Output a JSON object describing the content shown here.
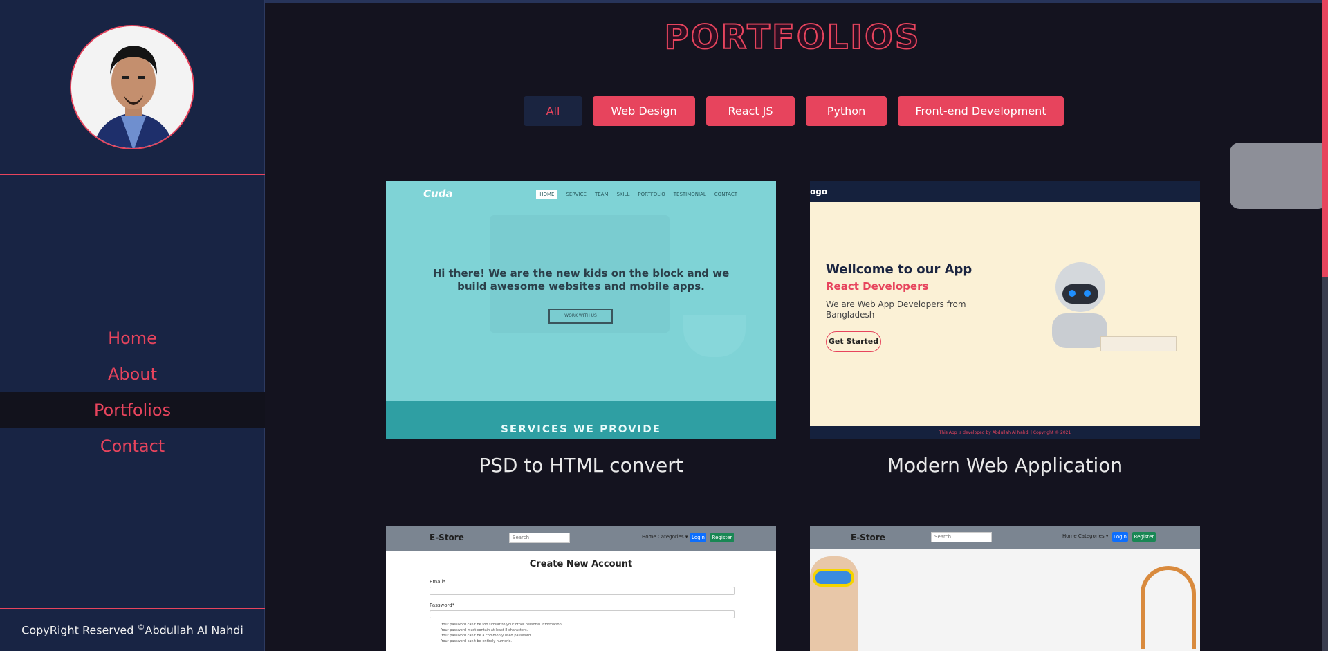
{
  "sidebar": {
    "nav": [
      "Home",
      "About",
      "Portfolios",
      "Contact"
    ],
    "active": "Portfolios",
    "copyright_prefix": "CopyRight Reserved ",
    "copyright_mark": "©",
    "copyright_name": "Abdullah Al Nahdi"
  },
  "main": {
    "title": "PORTFOLIOS",
    "filters": [
      "All",
      "Web Design",
      "React JS",
      "Python",
      "Front-end Development"
    ],
    "active_filter": "All"
  },
  "cards": [
    {
      "title": "PSD to HTML convert",
      "preview": {
        "logo": "Cuda",
        "menu": [
          "HOME",
          "SERVICE",
          "TEAM",
          "SKILL",
          "PORTFOLIO",
          "TESTIMONIAL",
          "CONTACT"
        ],
        "hero_line1": "Hi there! We are the new kids on the block and we",
        "hero_line2": "build awesome websites and mobile apps.",
        "cta": "WORK WITH US",
        "section": "SERVICES WE PROVIDE"
      }
    },
    {
      "title": "Modern Web Application",
      "preview": {
        "logo": "ogo",
        "heading": "Wellcome to our App",
        "subheading": "React Developers",
        "text": "We are Web App Developers from Bangladesh",
        "button": "Get Started",
        "footer": "This App is developed by Abdullah Al Nahdi | Copyright © 2021"
      }
    },
    {
      "title": "",
      "preview": {
        "brand": "E-Store",
        "search": "Search",
        "links": "Home   Categories ▾",
        "login": "Login",
        "register": "Register",
        "heading": "Create New Account",
        "email_label": "Email*",
        "password_label": "Password*",
        "rules": [
          "Your password can't be too similar to your other personal information.",
          "Your password must contain at least 8 characters.",
          "Your password can't be a commonly used password.",
          "Your password can't be entirely numeric."
        ]
      }
    },
    {
      "title": "",
      "preview": {
        "brand": "E-Store",
        "search": "Search",
        "links": "Home   Categories ▾",
        "login": "Login",
        "register": "Register"
      }
    }
  ],
  "colors": {
    "accent": "#e7445d",
    "sidebar_bg": "#182444",
    "page_bg": "#14131f"
  }
}
